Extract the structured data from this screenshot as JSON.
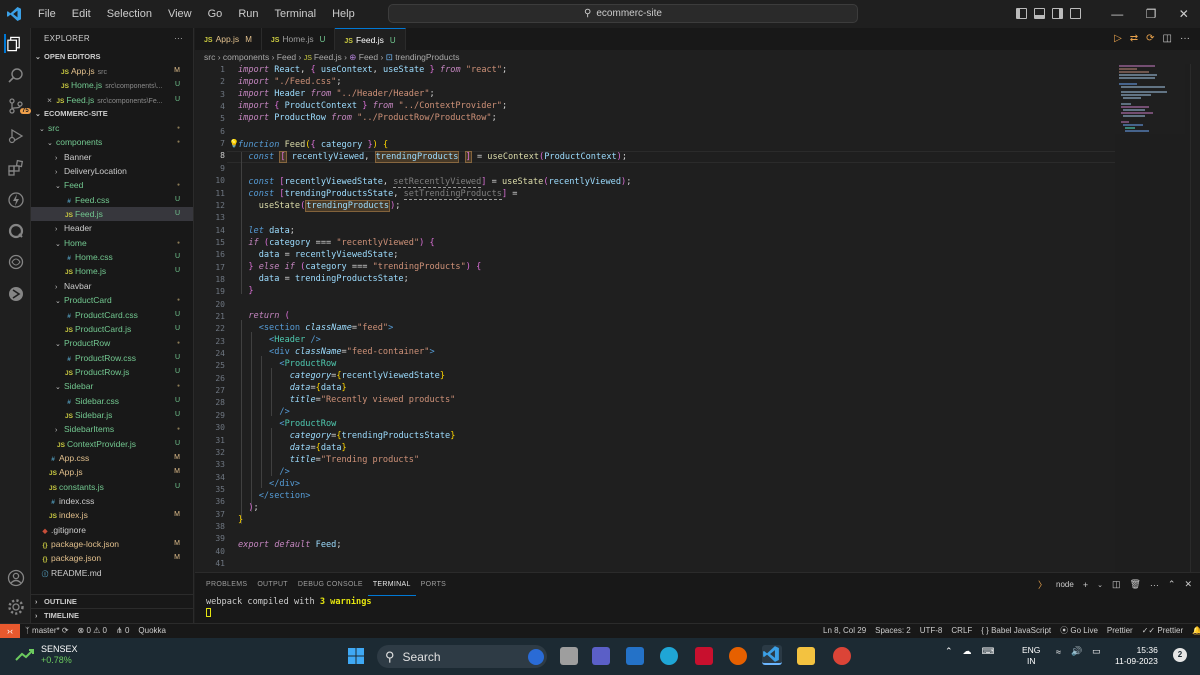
{
  "titlebar": {
    "menu": [
      "File",
      "Edit",
      "Selection",
      "View",
      "Go",
      "Run",
      "Terminal",
      "Help"
    ],
    "search": "ecommerc-site"
  },
  "sidebar": {
    "title": "EXPLORER",
    "open_editors_title": "OPEN EDITORS",
    "open_editors": [
      {
        "name": "App.js",
        "desc": "src",
        "status": "M",
        "type": "JS"
      },
      {
        "name": "Home.js",
        "desc": "src\\components\\...",
        "status": "U",
        "type": "JS"
      },
      {
        "name": "Feed.js",
        "desc": "src\\components\\Fe...",
        "status": "U",
        "type": "JS"
      }
    ],
    "project_title": "ECOMMERC-SITE",
    "tree": [
      {
        "name": "src",
        "kind": "folder",
        "depth": 0,
        "status": "dot"
      },
      {
        "name": "components",
        "kind": "folder",
        "depth": 1,
        "status": "dot"
      },
      {
        "name": "Banner",
        "kind": "folder-closed",
        "depth": 2,
        "status": ""
      },
      {
        "name": "DeliveryLocation",
        "kind": "folder-closed",
        "depth": 2,
        "status": ""
      },
      {
        "name": "Feed",
        "kind": "folder",
        "depth": 2,
        "status": "dot"
      },
      {
        "name": "Feed.css",
        "kind": "css",
        "depth": 3,
        "status": "U"
      },
      {
        "name": "Feed.js",
        "kind": "js",
        "depth": 3,
        "status": "U"
      },
      {
        "name": "Header",
        "kind": "folder-closed",
        "depth": 2,
        "status": ""
      },
      {
        "name": "Home",
        "kind": "folder",
        "depth": 2,
        "status": "dot"
      },
      {
        "name": "Home.css",
        "kind": "css",
        "depth": 3,
        "status": "U"
      },
      {
        "name": "Home.js",
        "kind": "js",
        "depth": 3,
        "status": "U"
      },
      {
        "name": "Navbar",
        "kind": "folder-closed",
        "depth": 2,
        "status": ""
      },
      {
        "name": "ProductCard",
        "kind": "folder",
        "depth": 2,
        "status": "dot"
      },
      {
        "name": "ProductCard.css",
        "kind": "css",
        "depth": 3,
        "status": "U"
      },
      {
        "name": "ProductCard.js",
        "kind": "js",
        "depth": 3,
        "status": "U"
      },
      {
        "name": "ProductRow",
        "kind": "folder",
        "depth": 2,
        "status": "dot"
      },
      {
        "name": "ProductRow.css",
        "kind": "css",
        "depth": 3,
        "status": "U"
      },
      {
        "name": "ProductRow.js",
        "kind": "js",
        "depth": 3,
        "status": "U"
      },
      {
        "name": "Sidebar",
        "kind": "folder",
        "depth": 2,
        "status": "dot"
      },
      {
        "name": "Sidebar.css",
        "kind": "css",
        "depth": 3,
        "status": "U"
      },
      {
        "name": "Sidebar.js",
        "kind": "js",
        "depth": 3,
        "status": "U"
      },
      {
        "name": "SidebarItems",
        "kind": "folder-closed",
        "depth": 2,
        "status": "dot"
      },
      {
        "name": "ContextProvider.js",
        "kind": "js",
        "depth": 2,
        "status": "U"
      },
      {
        "name": "App.css",
        "kind": "css",
        "depth": 1,
        "status": "M"
      },
      {
        "name": "App.js",
        "kind": "js",
        "depth": 1,
        "status": "M"
      },
      {
        "name": "constants.js",
        "kind": "js",
        "depth": 1,
        "status": "U"
      },
      {
        "name": "index.css",
        "kind": "css",
        "depth": 1,
        "status": ""
      },
      {
        "name": "index.js",
        "kind": "js",
        "depth": 1,
        "status": "M"
      },
      {
        "name": ".gitignore",
        "kind": "git",
        "depth": 0,
        "status": ""
      },
      {
        "name": "package-lock.json",
        "kind": "json",
        "depth": 0,
        "status": "M"
      },
      {
        "name": "package.json",
        "kind": "json",
        "depth": 0,
        "status": "M"
      },
      {
        "name": "README.md",
        "kind": "md",
        "depth": 0,
        "status": ""
      }
    ],
    "outline": "OUTLINE",
    "timeline": "TIMELINE"
  },
  "tabs": [
    {
      "name": "App.js",
      "mod": "M",
      "active": false
    },
    {
      "name": "Home.js",
      "mod": "U",
      "active": false
    },
    {
      "name": "Feed.js",
      "mod": "U",
      "active": true
    }
  ],
  "breadcrumbs": [
    "src",
    "components",
    "Feed",
    "Feed.js",
    "Feed",
    "trendingProducts"
  ],
  "code_line_numbers": [
    "1",
    "2",
    "3",
    "4",
    "5",
    "6",
    "7",
    "8",
    "9",
    "10",
    "11",
    "12",
    "13",
    "14",
    "15",
    "16",
    "17",
    "18",
    "19",
    "20",
    "21",
    "22",
    "23",
    "24",
    "25",
    "26",
    "27",
    "28",
    "29",
    "30",
    "31",
    "32",
    "33",
    "34",
    "35",
    "36",
    "37",
    "38",
    "39",
    "40",
    "41"
  ],
  "panel": {
    "tabs": [
      "PROBLEMS",
      "OUTPUT",
      "DEBUG CONSOLE",
      "TERMINAL",
      "PORTS"
    ],
    "active_tab": "TERMINAL",
    "shell": "node",
    "terminal_text": "webpack compiled with ",
    "terminal_warn": "3 warnings"
  },
  "statusbar": {
    "branch": "master*",
    "errors": "0",
    "warnings": "0",
    "ports": "0",
    "quokka": "Quokka",
    "position": "Ln 8, Col 29",
    "spaces": "Spaces: 2",
    "encoding": "UTF-8",
    "eol": "CRLF",
    "language": "Babel JavaScript",
    "golive": "Go Live",
    "prettier": "Prettier",
    "prettier2": "Prettier"
  },
  "taskbar": {
    "weather_title": "SENSEX",
    "weather_value": "+0.78%",
    "search": "Search",
    "lang1": "ENG",
    "lang2": "IN",
    "time": "15:36",
    "date": "11-09-2023",
    "notifications": "2"
  },
  "colors": {
    "accent": "#0078d4",
    "modified": "#e2c08d",
    "untracked": "#73c991",
    "remote": "#e8592e"
  }
}
